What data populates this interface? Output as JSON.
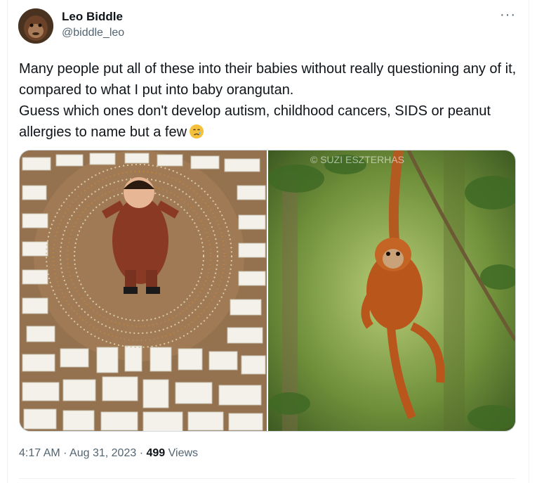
{
  "author": {
    "name": "Leo Biddle",
    "handle": "@biddle_leo"
  },
  "tweet": {
    "lines": [
      "Many people put all of these into their babies without really questioning any of it, compared to what I put into baby orangutan.",
      "Guess which ones don't develop autism, childhood cancers, SIDS or peanut allergies to name but a few"
    ],
    "emoji": "crying-face-emoji"
  },
  "media": {
    "watermark": "© SUZI ESZTERHAS"
  },
  "meta": {
    "time": "4:17 AM",
    "sep1": "·",
    "date": "Aug 31, 2023",
    "sep2": "·",
    "views": "499",
    "views_label": "Views"
  },
  "more_label": "···",
  "colors": {
    "text": "#0f1419",
    "secondary": "#536471",
    "border": "#cfd9de"
  }
}
